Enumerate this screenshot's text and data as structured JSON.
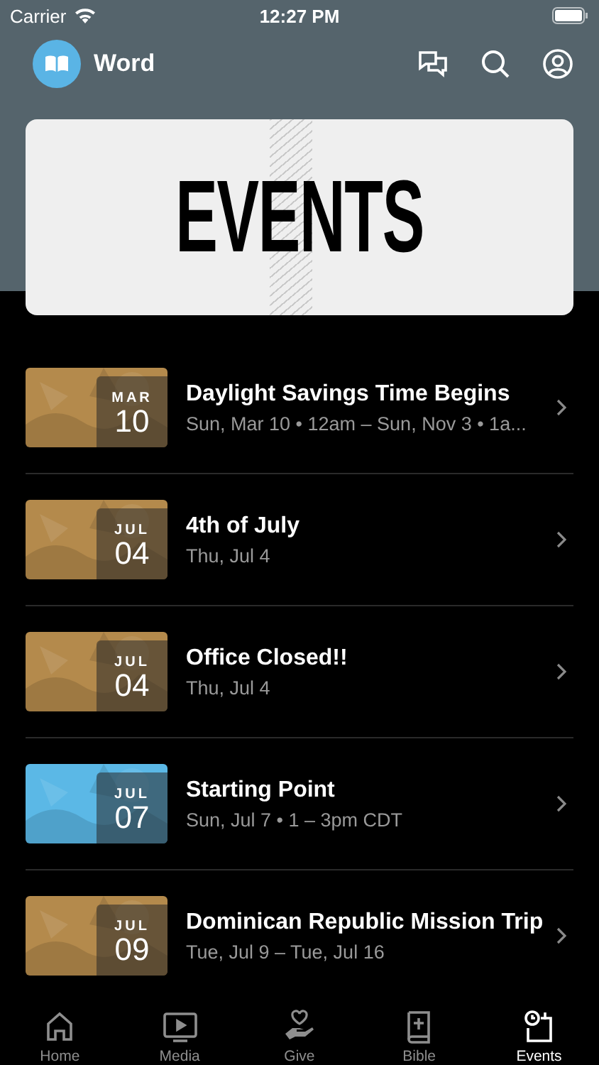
{
  "status_bar": {
    "carrier": "Carrier",
    "time": "12:27 PM"
  },
  "header": {
    "app_name": "Word"
  },
  "banner": {
    "title": "EVENTS"
  },
  "events": [
    {
      "month": "MAR",
      "day": "10",
      "title": "Daylight Savings Time Begins",
      "subtitle": "Sun, Mar 10 • 12am – Sun, Nov 3 • 1a..."
    },
    {
      "month": "JUL",
      "day": "04",
      "title": "4th of July",
      "subtitle": "Thu, Jul 4"
    },
    {
      "month": "JUL",
      "day": "04",
      "title": "Office Closed!!",
      "subtitle": "Thu, Jul 4"
    },
    {
      "month": "JUL",
      "day": "07",
      "title": "Starting Point",
      "subtitle": "Sun, Jul 7 • 1 – 3pm CDT",
      "kind": "graphic"
    },
    {
      "month": "JUL",
      "day": "09",
      "title": "Dominican Republic Mission Trip",
      "subtitle": "Tue, Jul 9 – Tue, Jul 16"
    }
  ],
  "tabs": [
    {
      "label": "Home",
      "selected": false
    },
    {
      "label": "Media",
      "selected": false
    },
    {
      "label": "Give",
      "selected": false
    },
    {
      "label": "Bible",
      "selected": false
    },
    {
      "label": "Events",
      "selected": true
    }
  ]
}
